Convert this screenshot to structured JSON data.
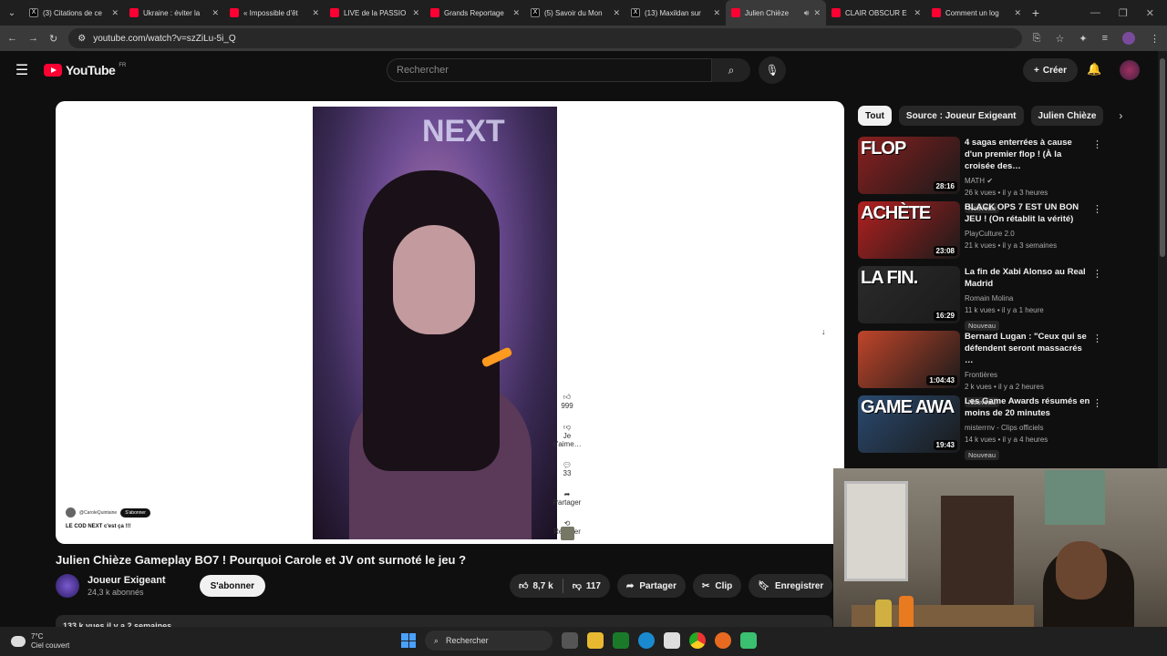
{
  "browser": {
    "tabs": [
      {
        "label": "(3) Citations de ce",
        "kind": "x"
      },
      {
        "label": "Ukraine : éviter la",
        "kind": "yt"
      },
      {
        "label": "« Impossible d'êt",
        "kind": "yt"
      },
      {
        "label": "LIVE de la PASSIO",
        "kind": "yt"
      },
      {
        "label": "Grands Reportage",
        "kind": "yt"
      },
      {
        "label": "(5) Savoir du Mon",
        "kind": "x"
      },
      {
        "label": "(13) Maxildan sur",
        "kind": "x"
      },
      {
        "label": "Julien Chièze",
        "kind": "yt",
        "active": true
      },
      {
        "label": "CLAIR OBSCUR E",
        "kind": "yt"
      },
      {
        "label": "Comment un log",
        "kind": "yt"
      }
    ],
    "url": "youtube.com/watch?v=szZiLu-5i_Q"
  },
  "youtube": {
    "logo_text": "YouTube",
    "country": "FR",
    "search_placeholder": "Rechercher",
    "create_label": "Créer"
  },
  "player": {
    "caption_user": "@CaroleQuintaine",
    "caption_subscribe": "S'abonner",
    "caption_text": "LE COD NEXT c'est ça !!!",
    "side_actions": [
      "999",
      "Je n'aime…",
      "33",
      "Partager",
      "Remixer"
    ]
  },
  "video": {
    "title": "Julien Chièze Gameplay BO7 ! Pourquoi Carole et JV ont surnoté le jeu ?",
    "channel": "Joueur Exigeant",
    "subscribers": "24,3 k abonnés",
    "subscribe_label": "S'abonner",
    "likes": "8,7 k",
    "dislikes": "117",
    "share_label": "Partager",
    "clip_label": "Clip",
    "save_label": "Enregistrer",
    "views_line": "133 k vues  il y a 2 semaines"
  },
  "chips": [
    "Tout",
    "Source : Joueur Exigeant",
    "Julien Chièze"
  ],
  "recommendations": [
    {
      "title": "4 sagas enterrées à cause d'un premier flop ! (À la croisée des…",
      "channel": "MATH",
      "verified": true,
      "meta": "26 k vues • il y a 3 heures",
      "badge": "Nouveau",
      "duration": "28:16",
      "thumb_text": "FLOP",
      "thumb_color": "#8a1f1f"
    },
    {
      "title": "BLACK OPS 7 EST UN BON JEU ! (On rétablit la vérité)",
      "channel": "PlayCulture 2.0",
      "verified": false,
      "meta": "21 k vues • il y a 3 semaines",
      "badge": "",
      "duration": "23:08",
      "thumb_text": "ACHÈTE",
      "thumb_color": "#b32020"
    },
    {
      "title": "La fin de Xabi Alonso au Real Madrid",
      "channel": "Romain Molina",
      "verified": false,
      "meta": "11 k vues • il y a 1 heure",
      "badge": "Nouveau",
      "duration": "16:29",
      "thumb_text": "LA FIN.",
      "thumb_color": "#2b2b2b"
    },
    {
      "title": "Bernard Lugan : \"Ceux qui se défendent seront massacrés …",
      "channel": "Frontières",
      "verified": false,
      "meta": "2 k vues • il y a 2 heures",
      "badge": "Nouveau",
      "duration": "1:04:43",
      "thumb_text": "",
      "thumb_color": "#c0452a"
    },
    {
      "title": "Les Game Awards résumés en moins de 20 minutes",
      "channel": "misterrnv - Clips officiels",
      "verified": false,
      "meta": "14 k vues • il y a 4 heures",
      "badge": "Nouveau",
      "duration": "19:43",
      "thumb_text": "GAME AWA",
      "thumb_color": "#2a4a70"
    }
  ],
  "taskbar": {
    "temperature": "7°C",
    "weather": "Ciel couvert",
    "search_label": "Rechercher"
  }
}
